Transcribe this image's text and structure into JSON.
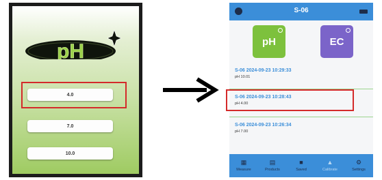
{
  "left_app": {
    "logo_text": "pH",
    "buttons": [
      "4.0",
      "7.0",
      "10.0"
    ]
  },
  "right_app": {
    "title": "S-06",
    "tiles": {
      "ph": "pH",
      "ec": "EC"
    },
    "records": [
      {
        "head": "S-06   2024-09-23 10:29:33",
        "value": "pH  10.01"
      },
      {
        "head": "S-06   2024-09-23 10:28:43",
        "value": "pH  4.00"
      },
      {
        "head": "S-06   2024-09-23 10:26:34",
        "value": "pH  7.00"
      }
    ],
    "tabs": [
      {
        "label": "Measure",
        "icon": "grid-icon"
      },
      {
        "label": "Products",
        "icon": "list-icon"
      },
      {
        "label": "Saved",
        "icon": "save-icon"
      },
      {
        "label": "Calibrate",
        "icon": "calibrate-icon"
      },
      {
        "label": "Settings",
        "icon": "gear-icon"
      }
    ]
  },
  "colors": {
    "accent_blue": "#3b8ed9",
    "ph_green": "#7dc13d",
    "ec_purple": "#7b64c9",
    "highlight_red": "#d42a2a"
  }
}
